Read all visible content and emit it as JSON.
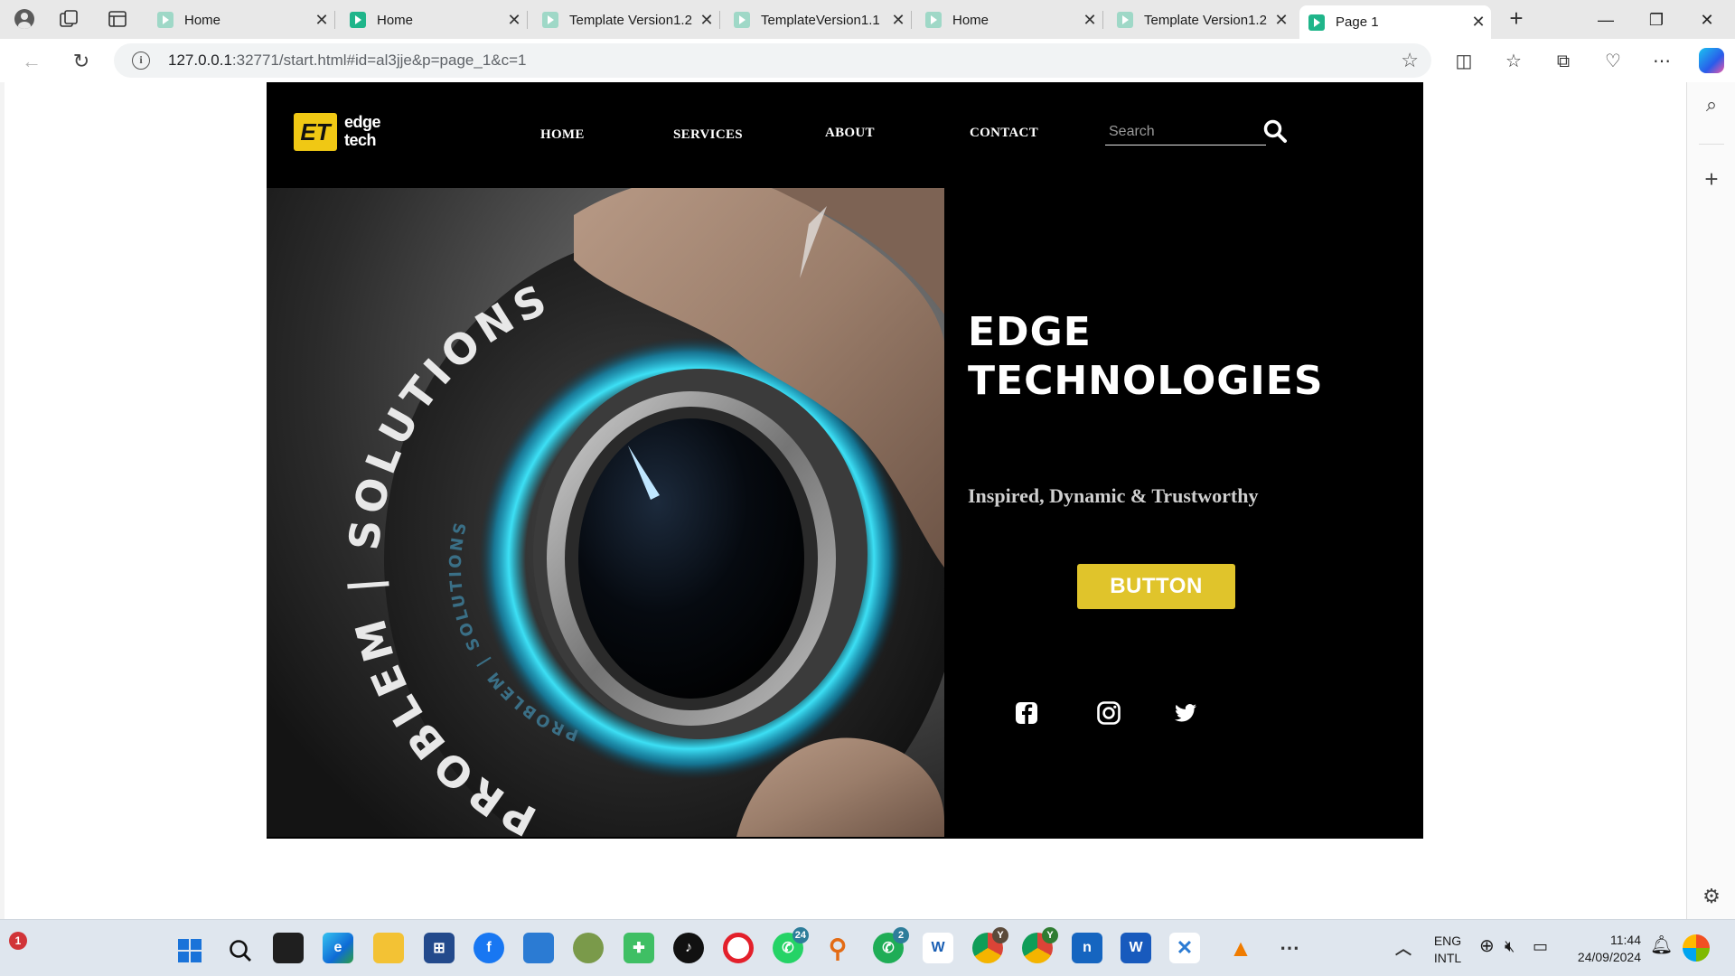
{
  "browser": {
    "tabs": [
      {
        "title": "Home",
        "active": false
      },
      {
        "title": "Home",
        "active": false
      },
      {
        "title": "Template Version1.2",
        "active": false
      },
      {
        "title": "TemplateVersion1.1",
        "active": false
      },
      {
        "title": "Home",
        "active": false
      },
      {
        "title": "Template Version1.2",
        "active": false
      },
      {
        "title": "Page 1",
        "active": true
      }
    ],
    "url_host": "127.0.0.1",
    "url_rest": ":32771/start.html#id=al3jje&p=page_1&c=1"
  },
  "site": {
    "logo": {
      "mark": "ET",
      "line1": "edge",
      "line2": "tech"
    },
    "nav": {
      "home": "HOME",
      "services": "SERVICES",
      "about": "ABOUT",
      "contact": "CONTACT"
    },
    "search": {
      "placeholder": "Search"
    },
    "hero": {
      "title_line1": "EDGE",
      "title_line2": "TECHNOLOGIES",
      "tagline": "Inspired, Dynamic & Trustworthy",
      "button": "BUTTON",
      "image_text_outer": "PROBLEM | SOLUTIONS",
      "image_text_inner": "PROBLEM | SOLUTIONS"
    },
    "colors": {
      "accent": "#e0c42b",
      "background": "#000000"
    },
    "social": [
      "facebook-icon",
      "instagram-icon",
      "twitter-icon"
    ]
  },
  "taskbar": {
    "notification_count": "1",
    "badges": {
      "whatsapp1": "24",
      "whatsapp2": "2",
      "chrome1": "Y",
      "chrome2": "Y"
    },
    "language": {
      "line1": "ENG",
      "line2": "INTL"
    },
    "time": "11:44",
    "date": "24/09/2024"
  }
}
